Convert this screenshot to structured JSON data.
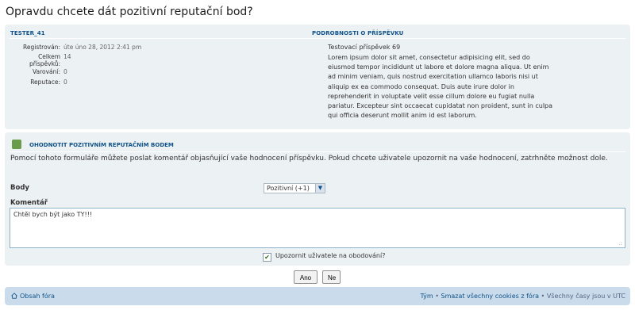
{
  "page": {
    "title": "Opravdu chcete dát pozitivní reputační bod?"
  },
  "user": {
    "name": "TESTER_41",
    "fields": [
      {
        "label": "Registrován:",
        "value": "úte úno 28, 2012 2:41 pm"
      },
      {
        "label": "Celkem příspěvků:",
        "value": "14"
      },
      {
        "label": "Varování:",
        "value": "0"
      },
      {
        "label": "Reputace:",
        "value": "0"
      }
    ]
  },
  "post": {
    "header": "PODROBNOSTI O PŘÍSPĚVKU",
    "title": "Testovací příspěvek 69",
    "body": "Lorem ipsum dolor sit amet, consectetur adipisicing elit, sed do eiusmod tempor incididunt ut labore et dolore magna aliqua. Ut enim ad minim veniam, quis nostrud exercitation ullamco laboris nisi ut aliquip ex ea commodo consequat. Duis aute irure dolor in reprehenderit in voluptate velit esse cillum dolore eu fugiat nulla pariatur. Excepteur sint occaecat cupidatat non proident, sunt in culpa qui officia deserunt mollit anim id est laborum."
  },
  "rep_form": {
    "header": "OHODNOTIT POZITIVNÍM REPUTAČNÍM BODEM",
    "description": "Pomocí tohoto formuláře můžete poslat komentář objasňující vaše hodnocení příspěvku. Pokud chcete uživatele upozornit na vaše hodnocení, zatrhněte možnost dole.",
    "points_label": "Body",
    "points_selected": "Pozitivní (+1)",
    "comment_label": "Komentář",
    "comment_value": "Chtěl bych být jako TY!!!",
    "notify_label": "Upozornit uživatele na obodování?",
    "notify_checked": true,
    "yes_label": "Ano",
    "no_label": "Ne"
  },
  "footer": {
    "home": "Obsah fóra",
    "team": "Tým",
    "sep1": " • ",
    "cookies": "Smazat všechny cookies z fóra",
    "sep2": " • ",
    "timezone": "Všechny časy jsou v UTC"
  },
  "colors": {
    "accent": "#105289",
    "panel": "#ecf1f3",
    "footer": "#cadceb",
    "rep_icon": "#6a9c49"
  }
}
